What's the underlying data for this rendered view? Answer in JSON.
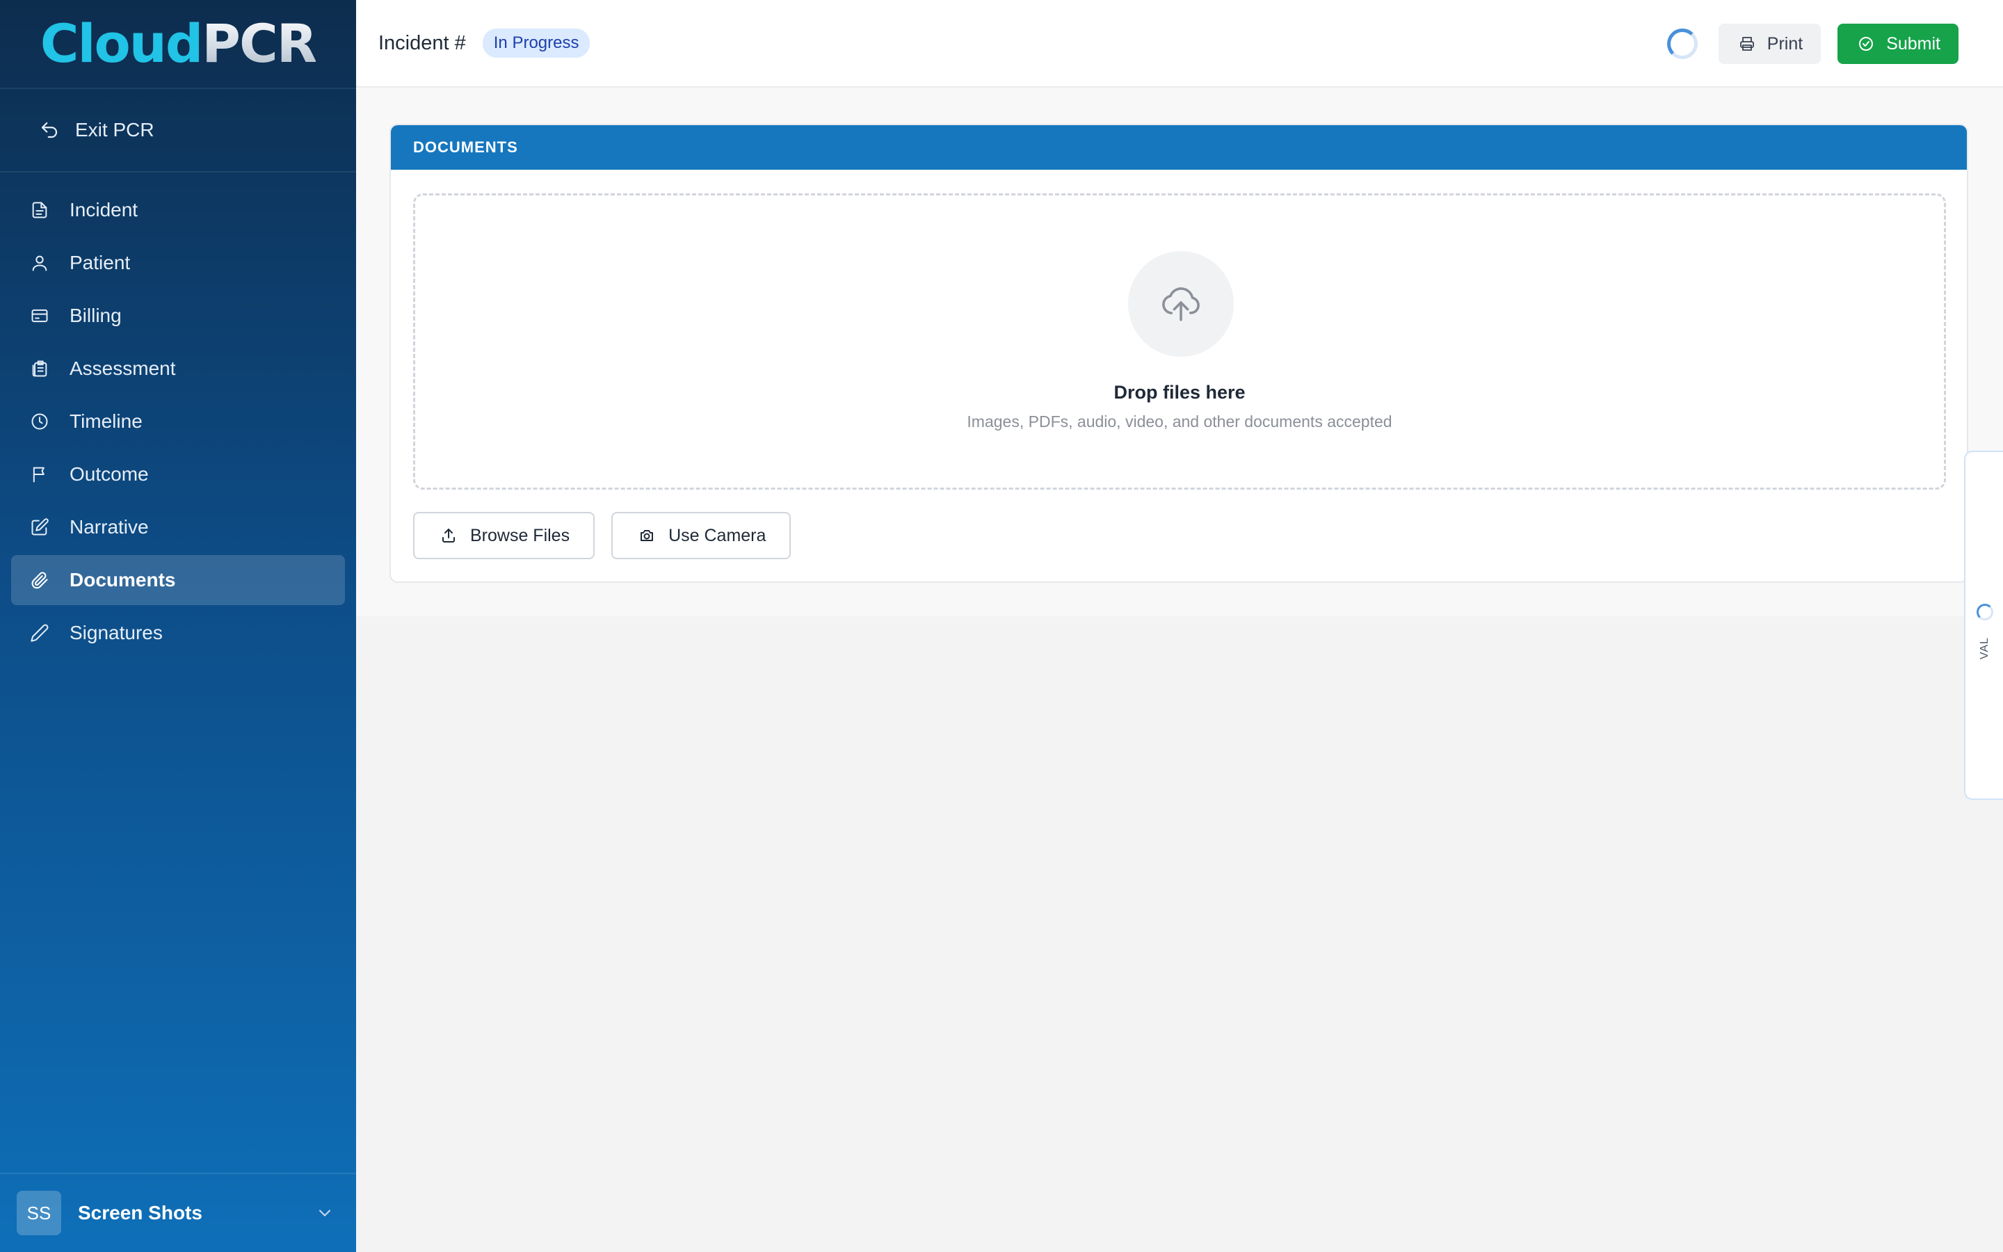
{
  "app": {
    "logo_cloud": "Cloud",
    "logo_pcr": "PCR"
  },
  "sidebar": {
    "exit_label": "Exit PCR",
    "items": [
      {
        "label": "Incident",
        "icon": "file-icon",
        "active": false
      },
      {
        "label": "Patient",
        "icon": "user-icon",
        "active": false
      },
      {
        "label": "Billing",
        "icon": "credit-card-icon",
        "active": false
      },
      {
        "label": "Assessment",
        "icon": "clipboard-icon",
        "active": false
      },
      {
        "label": "Timeline",
        "icon": "clock-icon",
        "active": false
      },
      {
        "label": "Outcome",
        "icon": "flag-icon",
        "active": false
      },
      {
        "label": "Narrative",
        "icon": "edit-icon",
        "active": false
      },
      {
        "label": "Documents",
        "icon": "paperclip-icon",
        "active": true
      },
      {
        "label": "Signatures",
        "icon": "pen-icon",
        "active": false
      }
    ],
    "user": {
      "initials": "SS",
      "name": "Screen Shots"
    }
  },
  "header": {
    "title": "Incident #",
    "status": "In Progress",
    "print_label": "Print",
    "submit_label": "Submit"
  },
  "documents": {
    "section_title": "DOCUMENTS",
    "drop_title": "Drop files here",
    "drop_subtitle": "Images, PDFs, audio, video, and other documents accepted",
    "browse_label": "Browse Files",
    "camera_label": "Use Camera"
  },
  "validation_tab": {
    "label": "VAL"
  },
  "colors": {
    "accent": "#1677be",
    "submit": "#16a34a",
    "status_badge_bg": "#dbeafe",
    "status_badge_text": "#1e40af"
  }
}
